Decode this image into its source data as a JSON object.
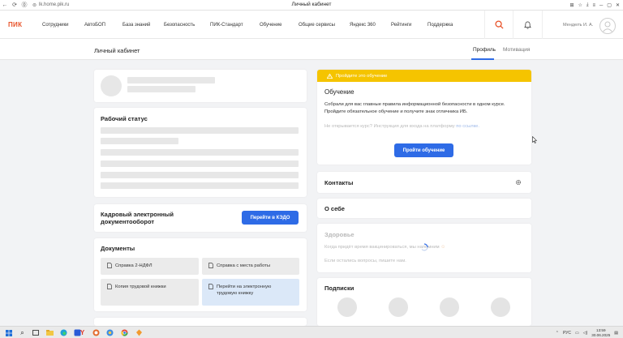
{
  "browser": {
    "url": "lk.home.pik.ru",
    "window_title": "Личный кабинет"
  },
  "header": {
    "logo": "ПИК",
    "nav": [
      "Сотрудники",
      "АвтоБОП",
      "База знаний",
      "Безопасность",
      "ПИК-Стандарт",
      "Обучение",
      "Общие сервисы",
      "Яндекс 360",
      "Рейтинги",
      "Поддержка"
    ],
    "user_name": "Менделъ И. А."
  },
  "subheader": {
    "title": "Личный кабинет",
    "tabs": [
      "Профиль",
      "Мотивация"
    ]
  },
  "work_status": {
    "title": "Рабочий статус"
  },
  "kedo": {
    "title": "Кадровый электронный документооборот",
    "button": "Перейти в КЭДО"
  },
  "documents": {
    "title": "Документы",
    "items": [
      "Справка 2-НДФЛ",
      "Справка с места работы",
      "Копия трудовой книжки",
      "Перейти на электронную трудовую книжку"
    ]
  },
  "training": {
    "banner": "Пройдите это обучение",
    "title": "Обучение",
    "text": "Собрали для вас главные правила информационной безопасности в одном курсе. Пройдите обязательное обучение и получите знак отличника ИБ.",
    "help_text": "Не открывается курс? Инструкция для входа на платформу",
    "help_link": "по ссылке.",
    "button": "Пройти обучение"
  },
  "contacts": {
    "title": "Контакты"
  },
  "about": {
    "title": "О себе"
  },
  "health": {
    "title": "Здоровье",
    "line1": "Когда придёт время вакцинироваться, мы напомним",
    "line2": "Если остались вопросы, пишите нам."
  },
  "subscriptions": {
    "title": "Подписки"
  },
  "taskbar": {
    "lang": "РУС",
    "time": "13:59",
    "date": "30.06.2025"
  },
  "colors": {
    "accent": "#2e6be6",
    "brand": "#e8532a",
    "banner": "#f5c400"
  }
}
